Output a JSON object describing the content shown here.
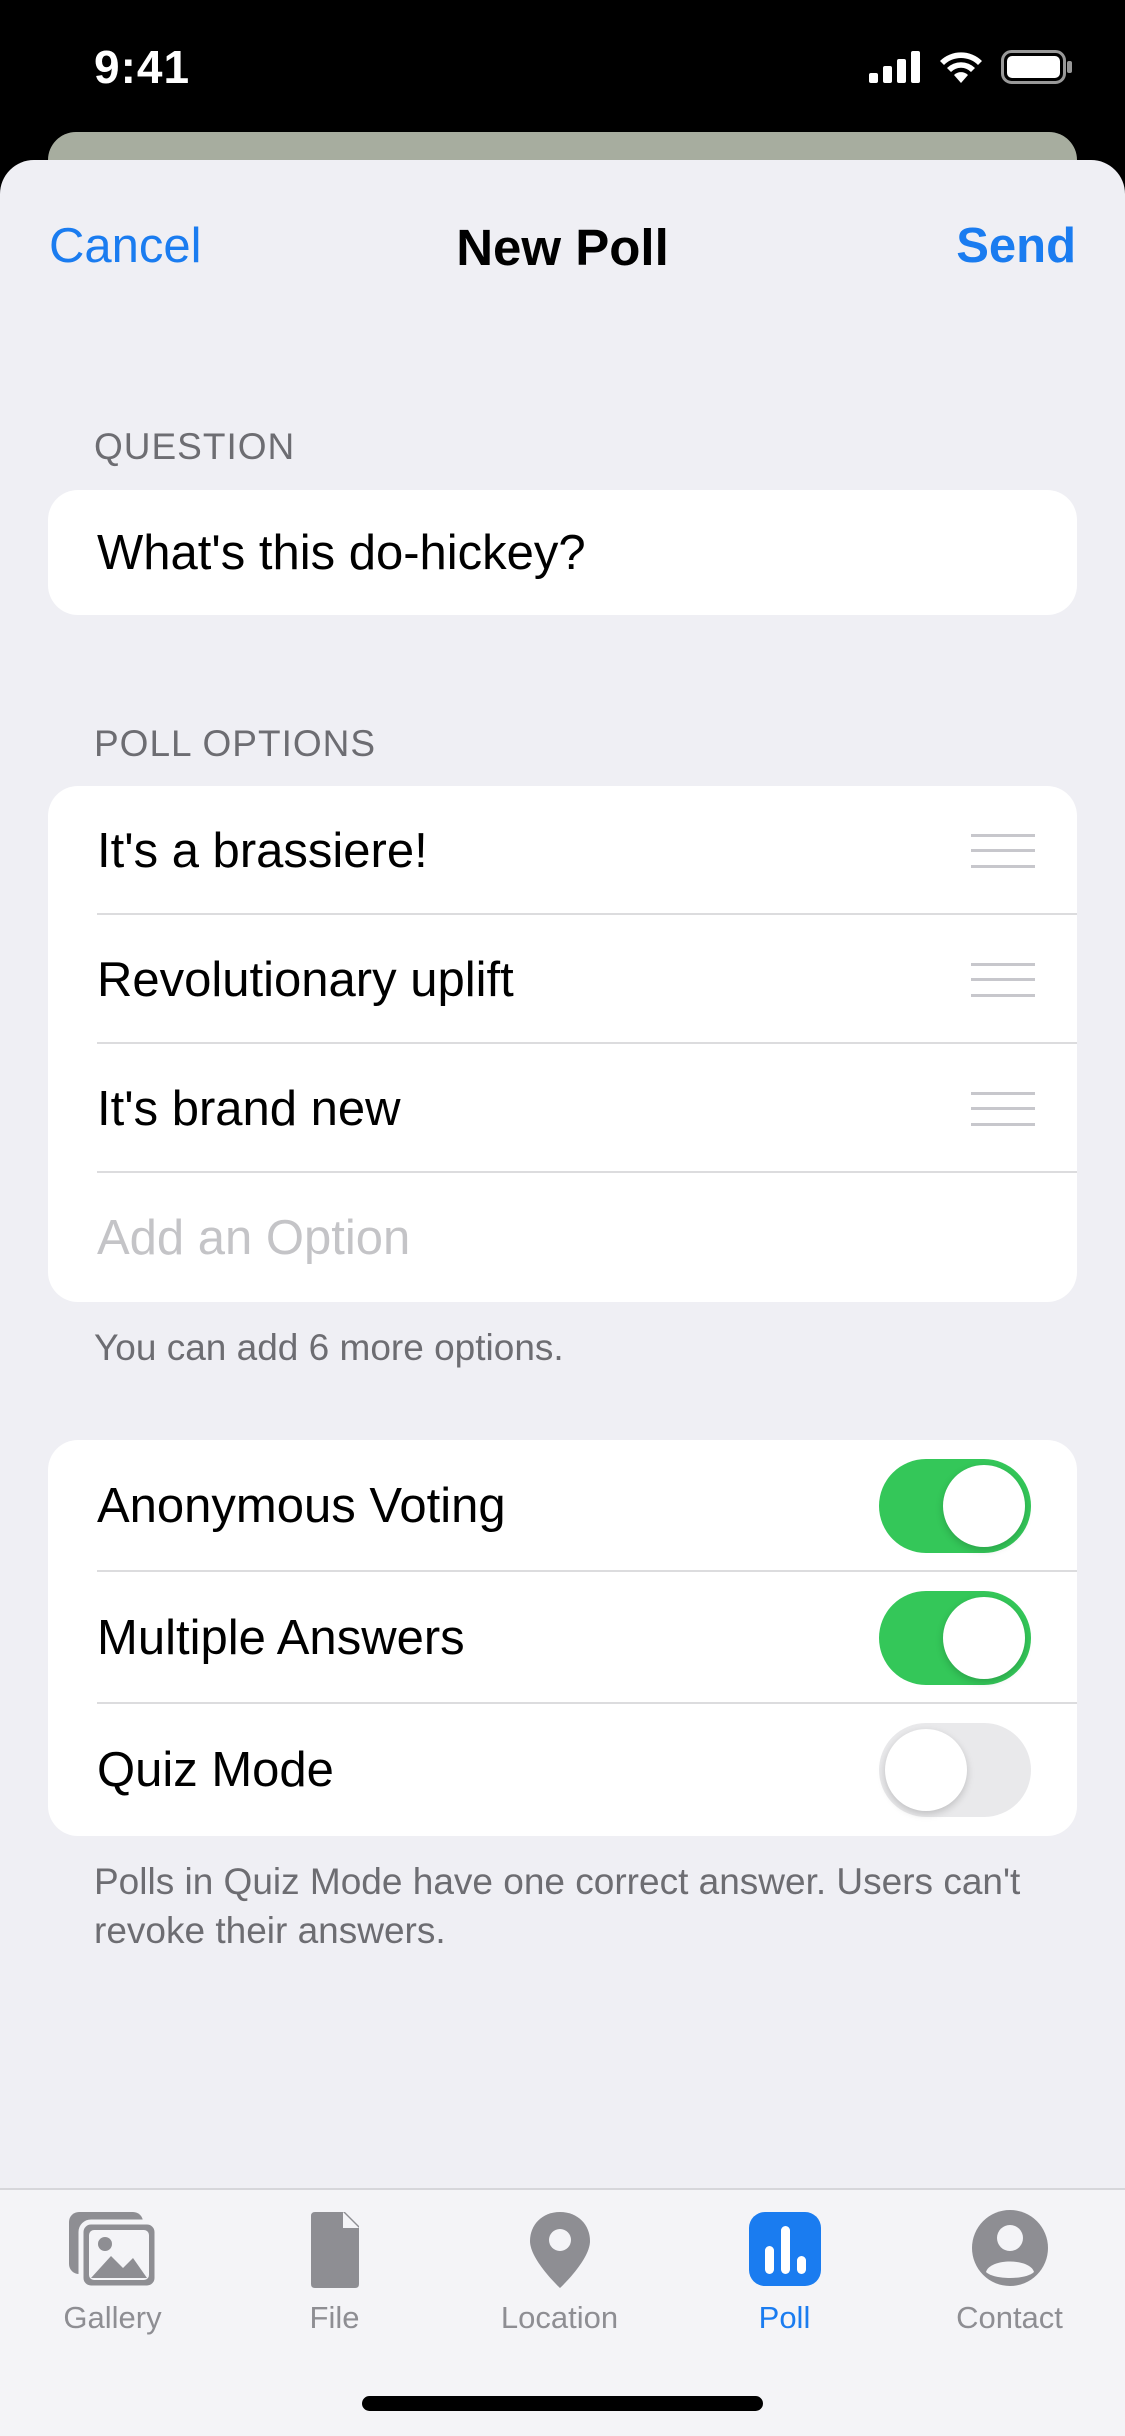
{
  "status_bar": {
    "time": "9:41"
  },
  "nav": {
    "cancel_label": "Cancel",
    "title": "New Poll",
    "send_label": "Send"
  },
  "question": {
    "header": "QUESTION",
    "value": "What's this do-hickey?"
  },
  "poll_options": {
    "header": "POLL OPTIONS",
    "items": [
      "It's a brassiere!",
      "Revolutionary uplift",
      "It's brand new"
    ],
    "add_placeholder": "Add an Option",
    "footer": "You can add 6 more options."
  },
  "settings": {
    "items": [
      {
        "label": "Anonymous Voting",
        "on": true
      },
      {
        "label": "Multiple Answers",
        "on": true
      },
      {
        "label": "Quiz Mode",
        "on": false
      }
    ],
    "footer": "Polls in Quiz Mode have one correct answer. Users can't revoke their answers."
  },
  "tabs": [
    {
      "label": "Gallery",
      "icon": "gallery-icon",
      "active": false
    },
    {
      "label": "File",
      "icon": "file-icon",
      "active": false
    },
    {
      "label": "Location",
      "icon": "location-pin-icon",
      "active": false
    },
    {
      "label": "Poll",
      "icon": "poll-icon",
      "active": true
    },
    {
      "label": "Contact",
      "icon": "contact-icon",
      "active": false
    }
  ],
  "colors": {
    "accent": "#1a7cf0",
    "toggle_on": "#34c759",
    "background": "#efeff4"
  }
}
